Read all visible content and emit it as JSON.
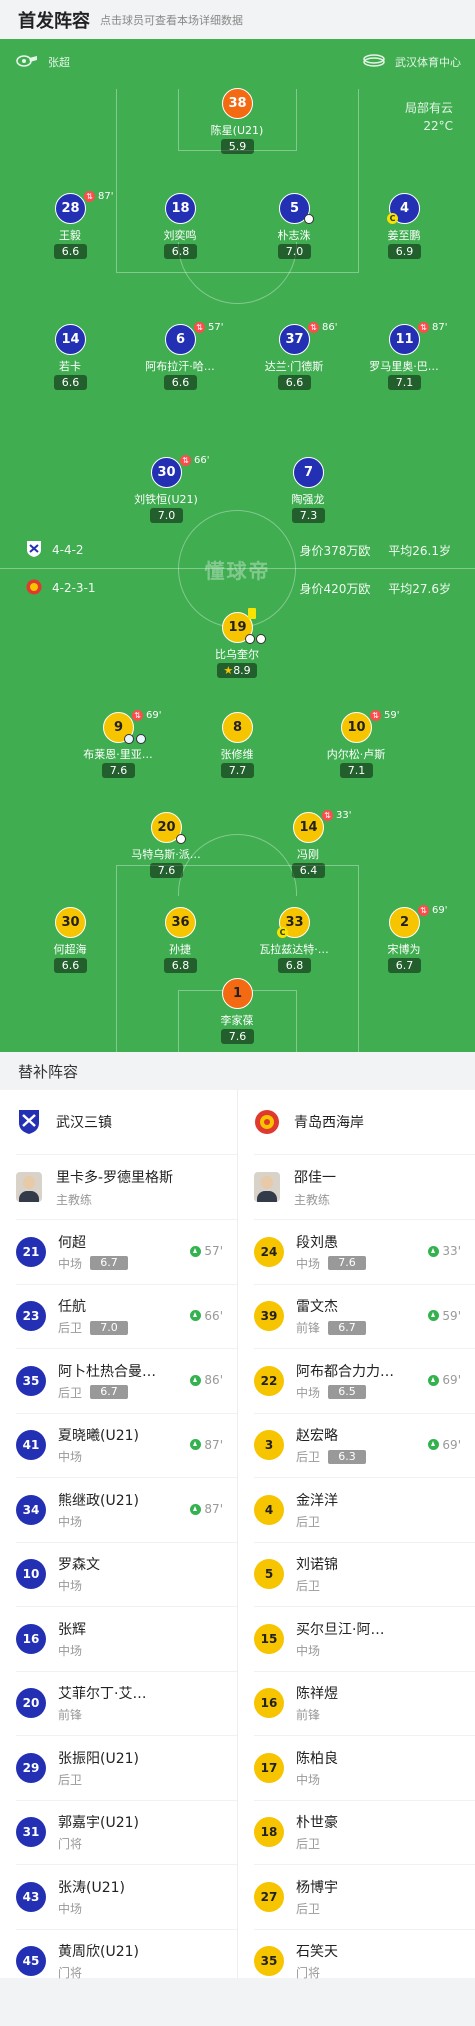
{
  "header": {
    "title": "首发阵容",
    "subtitle": "点击球员可查看本场详细数据"
  },
  "pitch_top": {
    "referee": "张超",
    "venue": "武汉体育中心"
  },
  "weather": {
    "condition": "局部有云",
    "temp": "22°C"
  },
  "watermark": "懂球帝",
  "home_info": {
    "formation": "4-4-2",
    "value": "身价378万欧",
    "age": "平均26.1岁"
  },
  "away_info": {
    "formation": "4-2-3-1",
    "value": "身价420万欧",
    "age": "平均27.6岁"
  },
  "home_lineup": [
    {
      "num": "38",
      "name": "陈星(U21)",
      "rating": "5.9",
      "gk": true
    },
    {
      "num": "28",
      "name": "王毅",
      "rating": "6.6",
      "sub": "87'"
    },
    {
      "num": "18",
      "name": "刘奕鸣",
      "rating": "6.8"
    },
    {
      "num": "5",
      "name": "朴志洙",
      "rating": "7.0",
      "goal": true
    },
    {
      "num": "4",
      "name": "姜至鹏",
      "rating": "6.9",
      "captain": true
    },
    {
      "num": "14",
      "name": "若卡",
      "rating": "6.6"
    },
    {
      "num": "6",
      "name": "阿布拉汗·哈…",
      "rating": "6.6",
      "sub": "57'"
    },
    {
      "num": "37",
      "name": "达兰·门德斯",
      "rating": "6.6",
      "sub": "86'"
    },
    {
      "num": "11",
      "name": "罗马里奥·巴…",
      "rating": "7.1",
      "sub": "87'"
    },
    {
      "num": "30",
      "name": "刘铁恒(U21)",
      "rating": "7.0",
      "sub": "66'"
    },
    {
      "num": "7",
      "name": "陶强龙",
      "rating": "7.3"
    }
  ],
  "away_lineup": [
    {
      "num": "19",
      "name": "比乌奎尔",
      "rating": "8.9",
      "mvp": true
    },
    {
      "num": "9",
      "name": "布莱恩·里亚…",
      "rating": "7.6",
      "sub": "69'"
    },
    {
      "num": "8",
      "name": "张修维",
      "rating": "7.7"
    },
    {
      "num": "10",
      "name": "内尔松·卢斯",
      "rating": "7.1",
      "sub": "59'"
    },
    {
      "num": "20",
      "name": "马特乌斯·派…",
      "rating": "7.6"
    },
    {
      "num": "14",
      "name": "冯刚",
      "rating": "6.4",
      "sub": "33'"
    },
    {
      "num": "30",
      "name": "何超海",
      "rating": "6.6"
    },
    {
      "num": "36",
      "name": "孙捷",
      "rating": "6.8"
    },
    {
      "num": "33",
      "name": "瓦拉兹达特·…",
      "rating": "6.8",
      "captain": true
    },
    {
      "num": "2",
      "name": "宋博为",
      "rating": "6.7",
      "sub": "69'"
    },
    {
      "num": "1",
      "name": "李家葆",
      "rating": "7.6",
      "gk": true
    }
  ],
  "subs_header": "替补阵容",
  "home_team": {
    "name": "武汉三镇",
    "coach": "里卡多-罗德里格斯",
    "coach_role": "主教练"
  },
  "away_team": {
    "name": "青岛西海岸",
    "coach": "邵佳一",
    "coach_role": "主教练"
  },
  "home_subs": [
    {
      "num": "21",
      "name": "何超",
      "pos": "中场",
      "rating": "6.7",
      "min": "57'"
    },
    {
      "num": "23",
      "name": "任航",
      "pos": "后卫",
      "rating": "7.0",
      "min": "66'"
    },
    {
      "num": "35",
      "name": "阿卜杜热合曼…",
      "pos": "后卫",
      "rating": "6.7",
      "min": "86'"
    },
    {
      "num": "41",
      "name": "夏晓曦(U21)",
      "pos": "中场",
      "min": "87'"
    },
    {
      "num": "34",
      "name": "熊继政(U21)",
      "pos": "中场",
      "min": "87'"
    },
    {
      "num": "10",
      "name": "罗森文",
      "pos": "中场"
    },
    {
      "num": "16",
      "name": "张辉",
      "pos": "中场"
    },
    {
      "num": "20",
      "name": "艾菲尔丁·艾…",
      "pos": "前锋"
    },
    {
      "num": "29",
      "name": "张振阳(U21)",
      "pos": "后卫"
    },
    {
      "num": "31",
      "name": "郭嘉宇(U21)",
      "pos": "门将"
    },
    {
      "num": "43",
      "name": "张涛(U21)",
      "pos": "中场"
    },
    {
      "num": "45",
      "name": "黄周欣(U21)",
      "pos": "门将"
    }
  ],
  "away_subs": [
    {
      "num": "24",
      "name": "段刘愚",
      "pos": "中场",
      "rating": "7.6",
      "min": "33'"
    },
    {
      "num": "39",
      "name": "雷文杰",
      "pos": "前锋",
      "rating": "6.7",
      "min": "59'"
    },
    {
      "num": "22",
      "name": "阿布都合力力…",
      "pos": "中场",
      "rating": "6.5",
      "min": "69'"
    },
    {
      "num": "3",
      "name": "赵宏略",
      "pos": "后卫",
      "rating": "6.3",
      "min": "69'"
    },
    {
      "num": "4",
      "name": "金洋洋",
      "pos": "后卫"
    },
    {
      "num": "5",
      "name": "刘诺锦",
      "pos": "后卫"
    },
    {
      "num": "15",
      "name": "买尔旦江·阿…",
      "pos": "中场"
    },
    {
      "num": "16",
      "name": "陈祥煜",
      "pos": "前锋"
    },
    {
      "num": "17",
      "name": "陈柏良",
      "pos": "中场"
    },
    {
      "num": "18",
      "name": "朴世豪",
      "pos": "后卫"
    },
    {
      "num": "27",
      "name": "杨博宇",
      "pos": "后卫"
    },
    {
      "num": "35",
      "name": "石笑天",
      "pos": "门将"
    }
  ],
  "colors": {
    "pitch": "#3fad50",
    "home": "#2430b4",
    "away": "#f7c400",
    "gk": "#f36a12"
  }
}
